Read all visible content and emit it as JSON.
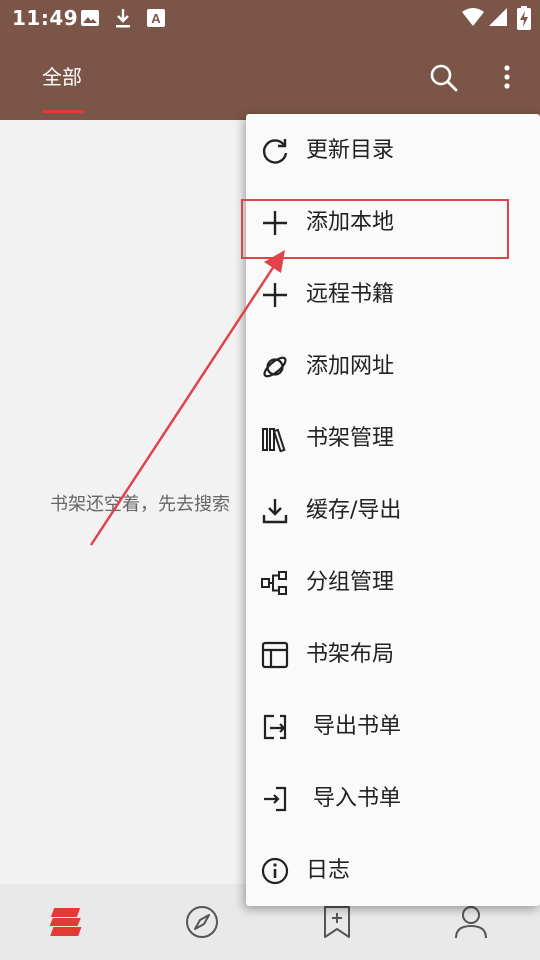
{
  "status_bar": {
    "time": "11:49",
    "left_icons": [
      "image-icon",
      "download-icon",
      "text-a-icon"
    ],
    "right_icons": [
      "wifi-icon",
      "signal-icon",
      "battery-charging-icon"
    ]
  },
  "app_bar": {
    "tab_label": "全部",
    "accent_color": "#7a5548",
    "tab_indicator_color": "#e53935",
    "actions": [
      "search-icon",
      "more-vert-icon"
    ]
  },
  "content": {
    "empty_message": "书架还空着，先去搜索"
  },
  "menu": {
    "items": [
      {
        "label": "更新目录",
        "icon": "refresh-icon"
      },
      {
        "label": "添加本地",
        "icon": "plus-icon"
      },
      {
        "label": "远程书籍",
        "icon": "plus-icon"
      },
      {
        "label": "添加网址",
        "icon": "planet-icon"
      },
      {
        "label": "书架管理",
        "icon": "books-icon"
      },
      {
        "label": "缓存/导出",
        "icon": "download-icon"
      },
      {
        "label": "分组管理",
        "icon": "group-icon"
      },
      {
        "label": "书架布局",
        "icon": "layout-icon"
      },
      {
        "label": "导出书单",
        "icon": "export-icon"
      },
      {
        "label": "导入书单",
        "icon": "import-icon"
      },
      {
        "label": "日志",
        "icon": "info-icon"
      }
    ]
  },
  "bottom_nav": {
    "items": [
      "bookshelf-icon",
      "explore-compass-icon",
      "bookmark-add-icon",
      "profile-icon"
    ],
    "active_color": "#e53935"
  },
  "annotation_color": "#e0444a"
}
